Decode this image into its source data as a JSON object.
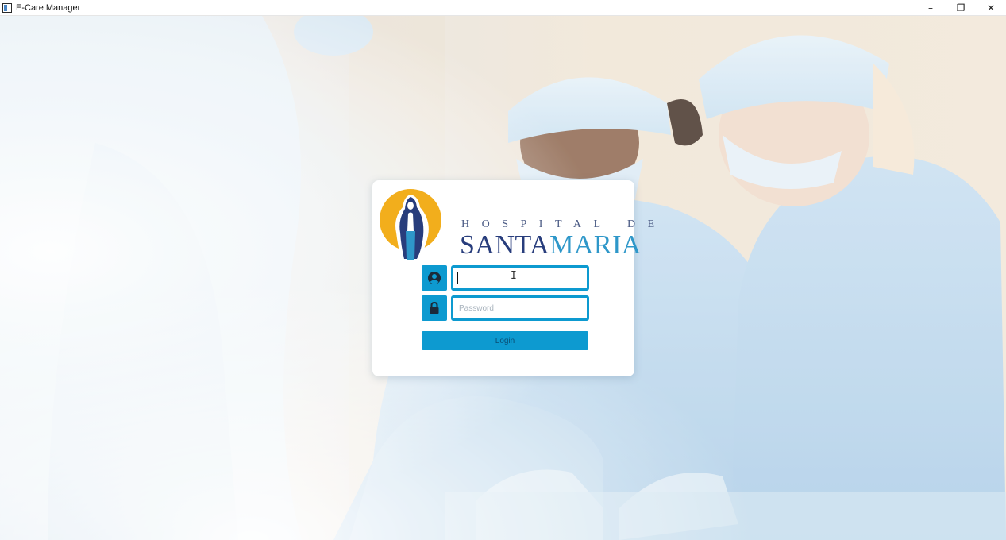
{
  "window": {
    "title": "E-Care Manager",
    "controls": {
      "minimize": "–",
      "restore": "❐",
      "close": "✕"
    }
  },
  "logo": {
    "line1": "HOSPITAL DE",
    "line2_part1": "SANTA",
    "line2_part2": "MARIA"
  },
  "login_form": {
    "username": {
      "value": "",
      "placeholder": "",
      "icon": "user-icon"
    },
    "password": {
      "value": "",
      "placeholder": "Password",
      "icon": "lock-icon"
    },
    "submit_label": "Login"
  },
  "colors": {
    "accent": "#0d9ad0",
    "logo_navy": "#283d7c",
    "logo_blue": "#2e97c9",
    "logo_gold": "#f2ae1c"
  }
}
